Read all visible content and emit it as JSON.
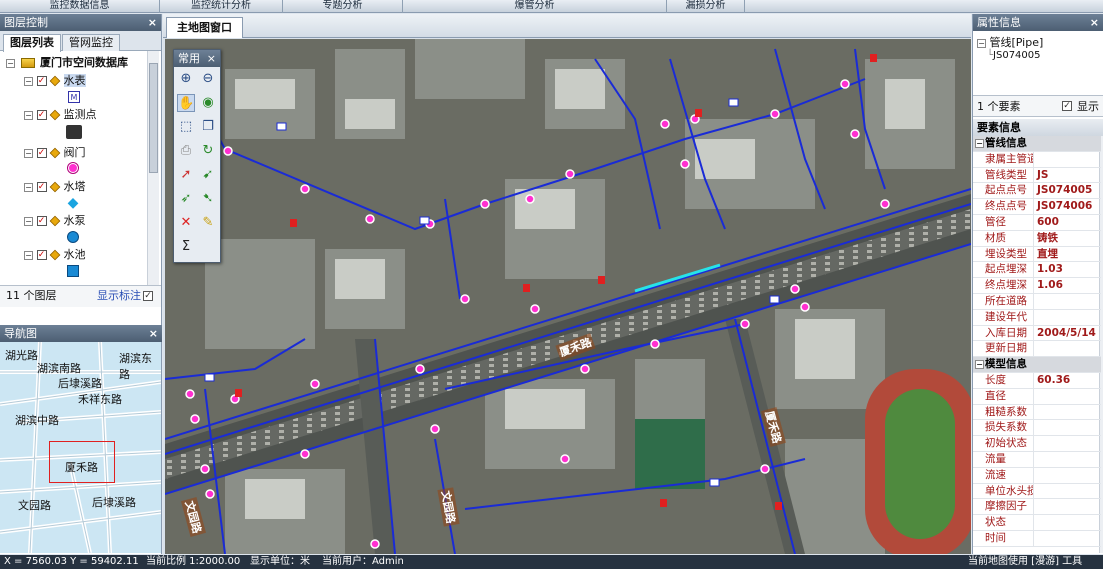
{
  "top_tabs": [
    "监控数据信息",
    "监控统计分析",
    "专题分析",
    "爆管分析",
    "漏损分析"
  ],
  "layer_panel": {
    "title": "图层控制",
    "close": "×",
    "tabs": [
      "图层列表",
      "管网监控"
    ],
    "root": "厦门市空间数据库",
    "layers": [
      {
        "name": "水表"
      },
      {
        "name": "监测点"
      },
      {
        "name": "阀门"
      },
      {
        "name": "水塔"
      },
      {
        "name": "水泵"
      },
      {
        "name": "水池"
      }
    ],
    "count": "11 个图层",
    "show_label": "显示标注",
    "show_label_checked": true
  },
  "nav_panel": {
    "title": "导航图",
    "close": "×",
    "roads": [
      "湖光路",
      "湖滨南路",
      "湖滨东路",
      "禾祥东路",
      "湖滨中路",
      "厦禾路",
      "文园路",
      "后埭溪路",
      "后埭溪路"
    ]
  },
  "map_window": {
    "tab": "主地图窗口",
    "toolbox": {
      "title": "常用",
      "close": "×",
      "tools": [
        "zoom-in",
        "zoom-out",
        "pan",
        "globe",
        "select",
        "refresh",
        "measure",
        "clear",
        "sum"
      ]
    },
    "labels": [
      "厦禾路",
      "厦禾路",
      "文园路",
      "文园路"
    ]
  },
  "attr_panel": {
    "title": "属性信息",
    "close": "×",
    "tree_root": "管线[Pipe]",
    "tree_child": "JS074005",
    "count": "1 个要素",
    "show": "显示",
    "show_checked": true
  },
  "feature_panel": {
    "title": "要素信息",
    "groups": [
      {
        "name": "管线信息",
        "rows": [
          [
            "隶属主管道",
            ""
          ],
          [
            "管线类型",
            "JS"
          ],
          [
            "起点点号",
            "JS074005"
          ],
          [
            "终点点号",
            "JS074006"
          ],
          [
            "管径",
            "600"
          ],
          [
            "材质",
            "铸铁"
          ],
          [
            "埋设类型",
            "直埋"
          ],
          [
            "起点埋深",
            "1.03"
          ],
          [
            "终点埋深",
            "1.06"
          ],
          [
            "所在道路",
            ""
          ],
          [
            "建设年代",
            ""
          ],
          [
            "入库日期",
            "2004/5/14"
          ],
          [
            "更新日期",
            ""
          ]
        ]
      },
      {
        "name": "模型信息",
        "rows": [
          [
            "长度",
            "60.36"
          ],
          [
            "直径",
            ""
          ],
          [
            "粗糙系数",
            ""
          ],
          [
            "损失系数",
            ""
          ],
          [
            "初始状态",
            ""
          ],
          [
            "流量",
            ""
          ],
          [
            "流速",
            ""
          ],
          [
            "单位水头损",
            ""
          ],
          [
            "摩擦因子",
            ""
          ],
          [
            "状态",
            ""
          ],
          [
            "时间",
            ""
          ]
        ]
      }
    ]
  },
  "status": {
    "coords": "X = 7560.03  Y = 59402.11",
    "scale": "当前比例 1:2000.00",
    "unit": "显示单位：米",
    "user": "当前用户：Admin",
    "right": "当前地图使用 [漫游] 工具"
  },
  "colors": {
    "panel_header": "#5a6d83",
    "pipe": "#1a2bd6",
    "node": "#ff2fd0",
    "highlight": "#27e3e8"
  }
}
